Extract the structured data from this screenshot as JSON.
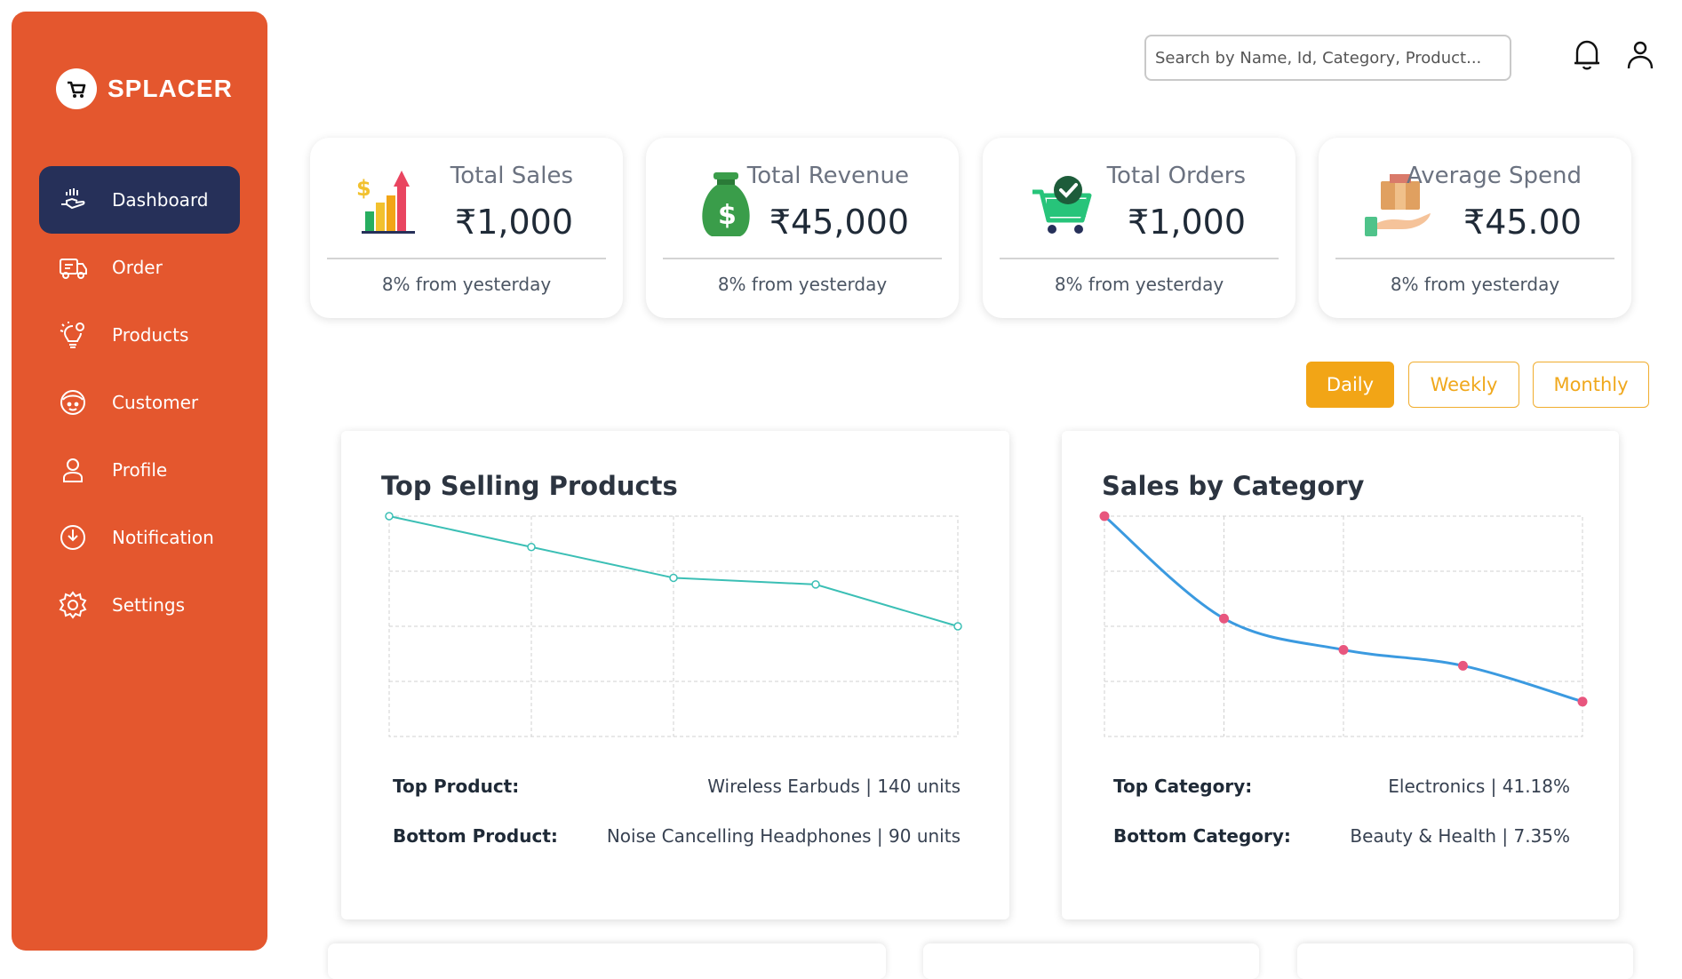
{
  "app": {
    "name": "SPLACER"
  },
  "sidebar": {
    "items": [
      {
        "label": "Dashboard",
        "icon": "hand-heart-icon",
        "active": true
      },
      {
        "label": "Order",
        "icon": "delivery-truck-icon",
        "active": false
      },
      {
        "label": "Products",
        "icon": "lightbulb-gear-icon",
        "active": false
      },
      {
        "label": "Customer",
        "icon": "customer-face-icon",
        "active": false
      },
      {
        "label": "Profile",
        "icon": "user-icon",
        "active": false
      },
      {
        "label": "Notification",
        "icon": "power-icon",
        "active": false
      },
      {
        "label": "Settings",
        "icon": "gear-icon",
        "active": false
      }
    ]
  },
  "header": {
    "search_placeholder": "Search by Name, Id, Category, Product...",
    "icons": [
      "bell-icon",
      "user-icon"
    ]
  },
  "stats": [
    {
      "title": "Total Sales",
      "value": "₹1,000",
      "footer": "8% from yesterday",
      "icon": "sales-chart-icon"
    },
    {
      "title": "Total Revenue",
      "value": "₹45,000",
      "footer": "8% from yesterday",
      "icon": "money-bag-icon"
    },
    {
      "title": "Total Orders",
      "value": "₹1,000",
      "footer": "8% from yesterday",
      "icon": "cart-check-icon"
    },
    {
      "title": "Average Spend",
      "value": "₹45.00",
      "footer": "8% from yesterday",
      "icon": "hand-box-icon"
    }
  ],
  "range": {
    "options": [
      "Daily",
      "Weekly",
      "Monthly"
    ],
    "selected": "Daily"
  },
  "panels": {
    "top_selling": {
      "title": "Top Selling Products",
      "top_label": "Top Product:",
      "top_value": "Wireless Earbuds | 140 units",
      "bottom_label": "Bottom Product:",
      "bottom_value": "Noise Cancelling Headphones | 90 units"
    },
    "sales_by_category": {
      "title": "Sales by Category",
      "top_label": "Top Category:",
      "top_value": "Electronics | 41.18%",
      "bottom_label": "Bottom Category:",
      "bottom_value": "Beauty & Health | 7.35%"
    }
  },
  "chart_data": [
    {
      "type": "line",
      "x": [
        1,
        2,
        3,
        4,
        5
      ],
      "series": [
        {
          "values": [
            140,
            126,
            112,
            109,
            90
          ]
        }
      ],
      "ylim": [
        40,
        140
      ],
      "color": "#3bbfb5",
      "grid": true
    },
    {
      "type": "line",
      "x": [
        1,
        2,
        3,
        4,
        5
      ],
      "series": [
        {
          "values": [
            41.18,
            22.5,
            16.8,
            13.9,
            7.35
          ]
        }
      ],
      "ylim": [
        1,
        41.18
      ],
      "color": "#3b9ae0",
      "marker_color": "#e8567e",
      "smooth": true,
      "grid": true
    }
  ]
}
